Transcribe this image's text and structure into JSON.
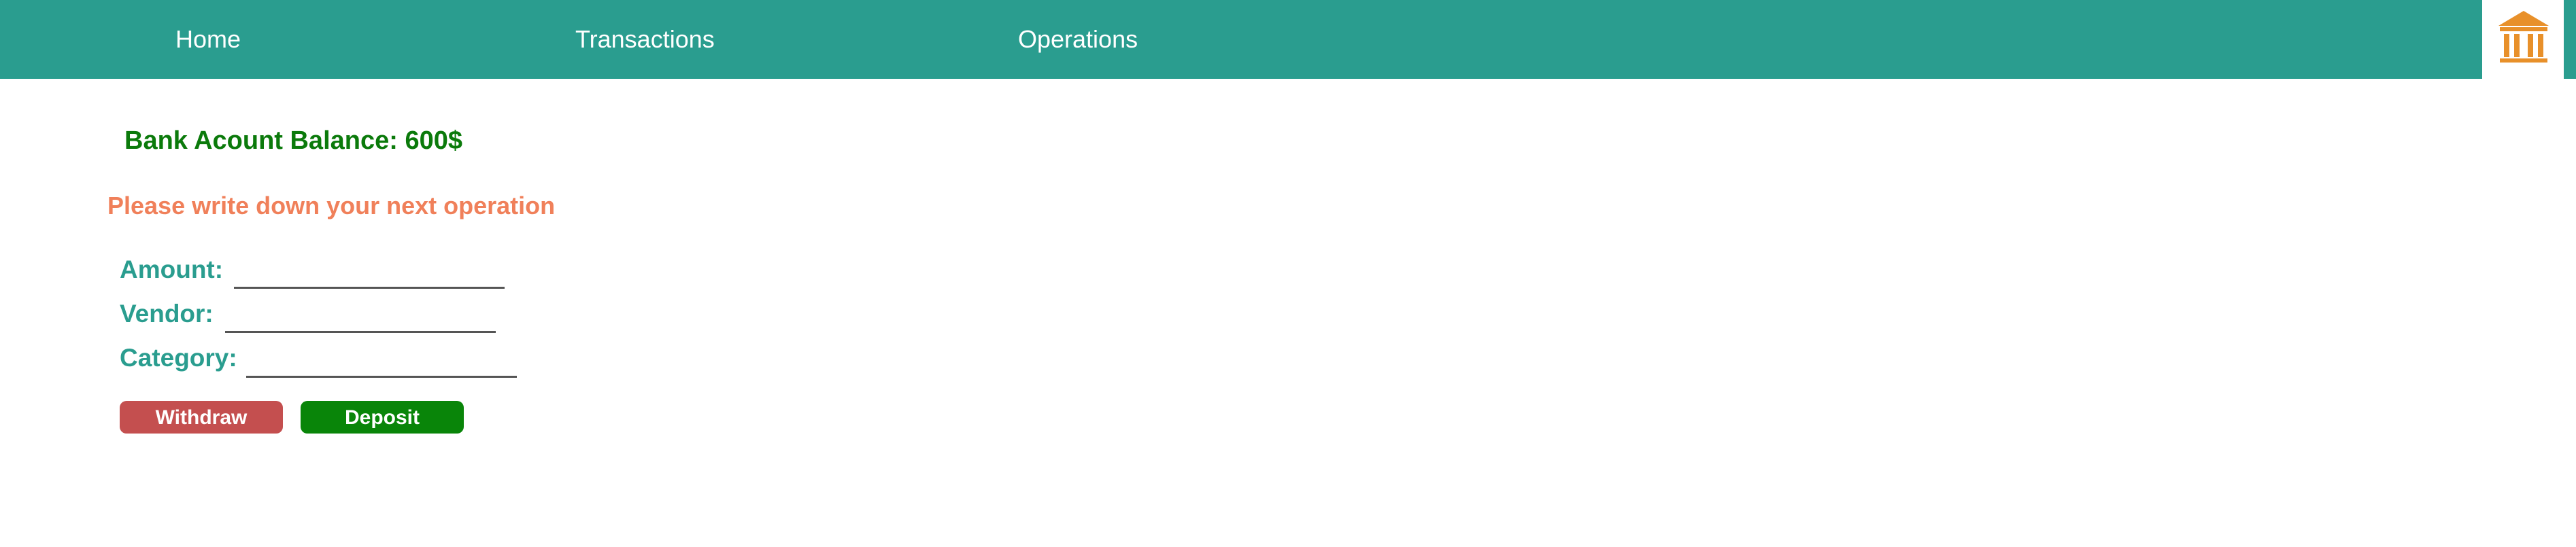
{
  "nav": {
    "items": [
      {
        "label": "Home"
      },
      {
        "label": "Transactions"
      },
      {
        "label": "Operations"
      }
    ],
    "logo_icon": "bank-building-icon",
    "bar_color": "#2a9d8f",
    "logo_color": "#e8902a"
  },
  "main": {
    "balance_text": "Bank Acount Balance: 600$",
    "prompt_text": "Please write down your next operation",
    "fields": {
      "amount": {
        "label": "Amount:",
        "value": ""
      },
      "vendor": {
        "label": "Vendor:",
        "value": ""
      },
      "category": {
        "label": "Category:",
        "value": ""
      }
    },
    "buttons": {
      "withdraw": {
        "label": "Withdraw",
        "color": "#c44f4f"
      },
      "deposit": {
        "label": "Deposit",
        "color": "#098509"
      }
    }
  }
}
